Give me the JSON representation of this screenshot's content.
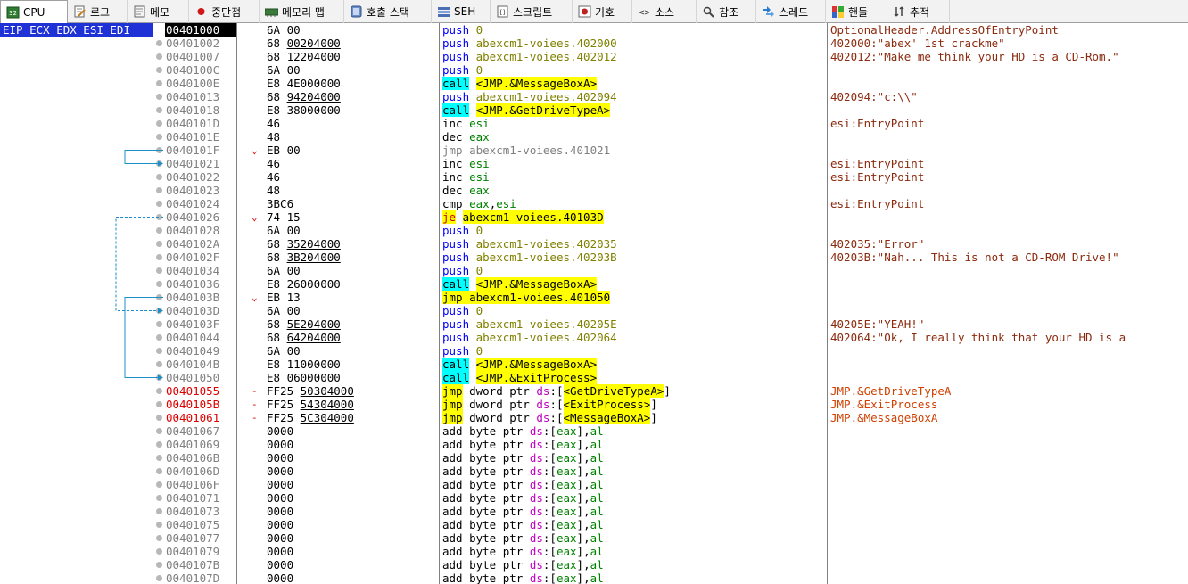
{
  "tabs": [
    {
      "label": "CPU",
      "icon": "cpu-icon",
      "active": true
    },
    {
      "label": "로그",
      "icon": "log-icon"
    },
    {
      "label": "메모",
      "icon": "notes-icon"
    },
    {
      "label": "중단점",
      "icon": "breakpoint-icon"
    },
    {
      "label": "메모리 맵",
      "icon": "memory-map-icon"
    },
    {
      "label": "호출 스택",
      "icon": "call-stack-icon"
    },
    {
      "label": "SEH",
      "icon": "seh-icon"
    },
    {
      "label": "스크립트",
      "icon": "script-icon"
    },
    {
      "label": "기호",
      "icon": "symbols-icon"
    },
    {
      "label": "소스",
      "icon": "source-icon"
    },
    {
      "label": "참조",
      "icon": "references-icon"
    },
    {
      "label": "스레드",
      "icon": "threads-icon"
    },
    {
      "label": "핸들",
      "icon": "handles-icon"
    },
    {
      "label": "추적",
      "icon": "trace-icon"
    }
  ],
  "register_label": "EIP ECX EDX ESI EDI",
  "rows": [
    {
      "addr": "00401000",
      "bytes": [
        [
          "6A 00",
          false
        ]
      ],
      "ins": [
        [
          "push",
          "mn-push"
        ],
        [
          " 0",
          "op-olive"
        ]
      ],
      "cmt": [
        [
          "OptionalHeader.AddressOfEntryPoint",
          "cm-brown"
        ]
      ],
      "current": true
    },
    {
      "addr": "00401002",
      "bytes": [
        [
          "68 ",
          false
        ],
        [
          "00204000",
          true
        ]
      ],
      "ins": [
        [
          "push",
          "mn-push"
        ],
        [
          " abexcm1-voiees.402000",
          "op-olive"
        ]
      ],
      "cmt": [
        [
          "402000:\"abex' 1st crackme\"",
          "cm-brown"
        ]
      ]
    },
    {
      "addr": "00401007",
      "bytes": [
        [
          "68 ",
          false
        ],
        [
          "12204000",
          true
        ]
      ],
      "ins": [
        [
          "push",
          "mn-push"
        ],
        [
          " abexcm1-voiees.402012",
          "op-olive"
        ]
      ],
      "cmt": [
        [
          "402012:\"Make me think your HD is a CD-Rom.\"",
          "cm-brown"
        ]
      ]
    },
    {
      "addr": "0040100C",
      "bytes": [
        [
          "6A 00",
          false
        ]
      ],
      "ins": [
        [
          "push",
          "mn-push"
        ],
        [
          " 0",
          "op-olive"
        ]
      ],
      "cmt": []
    },
    {
      "addr": "0040100E",
      "bytes": [
        [
          "E8 4E000000",
          false
        ]
      ],
      "ins": [
        [
          "call",
          "mn-blk hl-c"
        ],
        [
          " ",
          "op-blk"
        ],
        [
          "<JMP.&MessageBoxA>",
          "op-blk hl-y"
        ]
      ],
      "cmt": []
    },
    {
      "addr": "00401013",
      "bytes": [
        [
          "68 ",
          false
        ],
        [
          "94204000",
          true
        ]
      ],
      "ins": [
        [
          "push",
          "mn-push"
        ],
        [
          " abexcm1-voiees.402094",
          "op-olive"
        ]
      ],
      "cmt": [
        [
          "402094:\"c:\\\\\"",
          "cm-brown"
        ]
      ]
    },
    {
      "addr": "00401018",
      "bytes": [
        [
          "E8 38000000",
          false
        ]
      ],
      "ins": [
        [
          "call",
          "mn-blk hl-c"
        ],
        [
          " ",
          "op-blk"
        ],
        [
          "<JMP.&GetDriveTypeA>",
          "op-blk hl-y"
        ]
      ],
      "cmt": []
    },
    {
      "addr": "0040101D",
      "bytes": [
        [
          "46",
          false
        ]
      ],
      "ins": [
        [
          "inc",
          "mn-blk"
        ],
        [
          " esi",
          "op-gr"
        ]
      ],
      "cmt": [
        [
          "esi:EntryPoint",
          "cm-brown"
        ]
      ]
    },
    {
      "addr": "0040101E",
      "bytes": [
        [
          "48",
          false
        ]
      ],
      "ins": [
        [
          "dec",
          "mn-blk"
        ],
        [
          " eax",
          "op-gr"
        ]
      ],
      "cmt": []
    },
    {
      "addr": "0040101F",
      "mark": "⌄",
      "bytes": [
        [
          "EB 00",
          false
        ]
      ],
      "ins": [
        [
          "jmp",
          "mn-gray"
        ],
        [
          " abexcm1-voiees.401021",
          "op-gray"
        ]
      ],
      "cmt": []
    },
    {
      "addr": "00401021",
      "bytes": [
        [
          "46",
          false
        ]
      ],
      "ins": [
        [
          "inc",
          "mn-blk"
        ],
        [
          " esi",
          "op-gr"
        ]
      ],
      "cmt": [
        [
          "esi:EntryPoint",
          "cm-brown"
        ]
      ]
    },
    {
      "addr": "00401022",
      "bytes": [
        [
          "46",
          false
        ]
      ],
      "ins": [
        [
          "inc",
          "mn-blk"
        ],
        [
          " esi",
          "op-gr"
        ]
      ],
      "cmt": [
        [
          "esi:EntryPoint",
          "cm-brown"
        ]
      ]
    },
    {
      "addr": "00401023",
      "bytes": [
        [
          "48",
          false
        ]
      ],
      "ins": [
        [
          "dec",
          "mn-blk"
        ],
        [
          " eax",
          "op-gr"
        ]
      ],
      "cmt": []
    },
    {
      "addr": "00401024",
      "bytes": [
        [
          "3BC6",
          false
        ]
      ],
      "ins": [
        [
          "cmp",
          "mn-blk"
        ],
        [
          " eax",
          "op-gr"
        ],
        [
          ",",
          "op-blk"
        ],
        [
          "esi",
          "op-gr"
        ]
      ],
      "cmt": [
        [
          "esi:EntryPoint",
          "cm-brown"
        ]
      ]
    },
    {
      "addr": "00401026",
      "mark": "⌄",
      "bytes": [
        [
          "74 15",
          false
        ]
      ],
      "ins": [
        [
          "je",
          "mn-blk hl-y op-red"
        ],
        [
          " ",
          "op-blk"
        ],
        [
          "abexcm1-voiees.40103D",
          "op-blk hl-y"
        ]
      ],
      "cmt": []
    },
    {
      "addr": "00401028",
      "bytes": [
        [
          "6A 00",
          false
        ]
      ],
      "ins": [
        [
          "push",
          "mn-push"
        ],
        [
          " 0",
          "op-olive"
        ]
      ],
      "cmt": []
    },
    {
      "addr": "0040102A",
      "bytes": [
        [
          "68 ",
          false
        ],
        [
          "35204000",
          true
        ]
      ],
      "ins": [
        [
          "push",
          "mn-push"
        ],
        [
          " abexcm1-voiees.402035",
          "op-olive"
        ]
      ],
      "cmt": [
        [
          "402035:\"Error\"",
          "cm-brown"
        ]
      ]
    },
    {
      "addr": "0040102F",
      "bytes": [
        [
          "68 ",
          false
        ],
        [
          "3B204000",
          true
        ]
      ],
      "ins": [
        [
          "push",
          "mn-push"
        ],
        [
          " abexcm1-voiees.40203B",
          "op-olive"
        ]
      ],
      "cmt": [
        [
          "40203B:\"Nah... This is not a CD-ROM Drive!\"",
          "cm-brown"
        ]
      ]
    },
    {
      "addr": "00401034",
      "bytes": [
        [
          "6A 00",
          false
        ]
      ],
      "ins": [
        [
          "push",
          "mn-push"
        ],
        [
          " 0",
          "op-olive"
        ]
      ],
      "cmt": []
    },
    {
      "addr": "00401036",
      "bytes": [
        [
          "E8 26000000",
          false
        ]
      ],
      "ins": [
        [
          "call",
          "mn-blk hl-c"
        ],
        [
          " ",
          "op-blk"
        ],
        [
          "<JMP.&MessageBoxA>",
          "op-blk hl-y"
        ]
      ],
      "cmt": []
    },
    {
      "addr": "0040103B",
      "mark": "⌄",
      "bytes": [
        [
          "EB 13",
          false
        ]
      ],
      "ins": [
        [
          "jmp",
          "mn-blk hl-y"
        ],
        [
          " ",
          "op-blk hl-y"
        ],
        [
          "abexcm1-voiees.401050",
          "op-blk hl-y"
        ]
      ],
      "cmt": []
    },
    {
      "addr": "0040103D",
      "bytes": [
        [
          "6A 00",
          false
        ]
      ],
      "ins": [
        [
          "push",
          "mn-push"
        ],
        [
          " 0",
          "op-olive"
        ]
      ],
      "cmt": []
    },
    {
      "addr": "0040103F",
      "bytes": [
        [
          "68 ",
          false
        ],
        [
          "5E204000",
          true
        ]
      ],
      "ins": [
        [
          "push",
          "mn-push"
        ],
        [
          " abexcm1-voiees.40205E",
          "op-olive"
        ]
      ],
      "cmt": [
        [
          "40205E:\"YEAH!\"",
          "cm-brown"
        ]
      ]
    },
    {
      "addr": "00401044",
      "bytes": [
        [
          "68 ",
          false
        ],
        [
          "64204000",
          true
        ]
      ],
      "ins": [
        [
          "push",
          "mn-push"
        ],
        [
          " abexcm1-voiees.402064",
          "op-olive"
        ]
      ],
      "cmt": [
        [
          "402064:\"Ok, I really think that your HD is a",
          "cm-brown"
        ]
      ]
    },
    {
      "addr": "00401049",
      "bytes": [
        [
          "6A 00",
          false
        ]
      ],
      "ins": [
        [
          "push",
          "mn-push"
        ],
        [
          " 0",
          "op-olive"
        ]
      ],
      "cmt": []
    },
    {
      "addr": "0040104B",
      "bytes": [
        [
          "E8 11000000",
          false
        ]
      ],
      "ins": [
        [
          "call",
          "mn-blk hl-c"
        ],
        [
          " ",
          "op-blk"
        ],
        [
          "<JMP.&MessageBoxA>",
          "op-blk hl-y"
        ]
      ],
      "cmt": []
    },
    {
      "addr": "00401050",
      "bytes": [
        [
          "E8 06000000",
          false
        ]
      ],
      "ins": [
        [
          "call",
          "mn-blk hl-c"
        ],
        [
          " ",
          "op-blk"
        ],
        [
          "<JMP.&ExitProcess>",
          "op-blk hl-y"
        ]
      ],
      "cmt": []
    },
    {
      "addr": "00401055",
      "red": true,
      "mark": "-",
      "bytes": [
        [
          "FF25 ",
          false
        ],
        [
          "50304000",
          true
        ]
      ],
      "ins": [
        [
          "jmp",
          "mn-blk hl-y"
        ],
        [
          " dword ptr ",
          "op-blk"
        ],
        [
          "ds",
          "op-pink"
        ],
        [
          ":[",
          "op-blk"
        ],
        [
          "<GetDriveTypeA>",
          "op-blk hl-y"
        ],
        [
          "]",
          "op-blk"
        ]
      ],
      "cmt": [
        [
          "JMP.&GetDriveTypeA",
          "cm-eb"
        ]
      ]
    },
    {
      "addr": "0040105B",
      "red": true,
      "mark": "-",
      "bytes": [
        [
          "FF25 ",
          false
        ],
        [
          "54304000",
          true
        ]
      ],
      "ins": [
        [
          "jmp",
          "mn-blk hl-y"
        ],
        [
          " dword ptr ",
          "op-blk"
        ],
        [
          "ds",
          "op-pink"
        ],
        [
          ":[",
          "op-blk"
        ],
        [
          "<ExitProcess>",
          "op-blk hl-y"
        ],
        [
          "]",
          "op-blk"
        ]
      ],
      "cmt": [
        [
          "JMP.&ExitProcess",
          "cm-eb"
        ]
      ]
    },
    {
      "addr": "00401061",
      "red": true,
      "mark": "-",
      "bytes": [
        [
          "FF25 ",
          false
        ],
        [
          "5C304000",
          true
        ]
      ],
      "ins": [
        [
          "jmp",
          "mn-blk hl-y"
        ],
        [
          " dword ptr ",
          "op-blk"
        ],
        [
          "ds",
          "op-pink"
        ],
        [
          ":[",
          "op-blk"
        ],
        [
          "<MessageBoxA>",
          "op-blk hl-y"
        ],
        [
          "]",
          "op-blk"
        ]
      ],
      "cmt": [
        [
          "JMP.&MessageBoxA",
          "cm-eb"
        ]
      ]
    },
    {
      "addr": "00401067",
      "bytes": [
        [
          "0000",
          false
        ]
      ],
      "ins": "ADD",
      "cmt": []
    },
    {
      "addr": "00401069",
      "bytes": [
        [
          "0000",
          false
        ]
      ],
      "ins": "ADD",
      "cmt": []
    },
    {
      "addr": "0040106B",
      "bytes": [
        [
          "0000",
          false
        ]
      ],
      "ins": "ADD",
      "cmt": []
    },
    {
      "addr": "0040106D",
      "bytes": [
        [
          "0000",
          false
        ]
      ],
      "ins": "ADD",
      "cmt": []
    },
    {
      "addr": "0040106F",
      "bytes": [
        [
          "0000",
          false
        ]
      ],
      "ins": "ADD",
      "cmt": []
    },
    {
      "addr": "00401071",
      "bytes": [
        [
          "0000",
          false
        ]
      ],
      "ins": "ADD",
      "cmt": []
    },
    {
      "addr": "00401073",
      "bytes": [
        [
          "0000",
          false
        ]
      ],
      "ins": "ADD",
      "cmt": []
    },
    {
      "addr": "00401075",
      "bytes": [
        [
          "0000",
          false
        ]
      ],
      "ins": "ADD",
      "cmt": []
    },
    {
      "addr": "00401077",
      "bytes": [
        [
          "0000",
          false
        ]
      ],
      "ins": "ADD",
      "cmt": []
    },
    {
      "addr": "00401079",
      "bytes": [
        [
          "0000",
          false
        ]
      ],
      "ins": "ADD",
      "cmt": []
    },
    {
      "addr": "0040107B",
      "bytes": [
        [
          "0000",
          false
        ]
      ],
      "ins": "ADD",
      "cmt": []
    },
    {
      "addr": "0040107D",
      "bytes": [
        [
          "0000",
          false
        ]
      ],
      "ins": "ADD",
      "cmt": []
    }
  ],
  "add_ins": [
    [
      "add",
      "mn-blk"
    ],
    [
      " byte ptr ",
      "op-blk"
    ],
    [
      "ds",
      "op-pink"
    ],
    [
      ":[",
      "op-blk"
    ],
    [
      "eax",
      "op-gr"
    ],
    [
      "],",
      "op-blk"
    ],
    [
      "al",
      "op-gr"
    ]
  ],
  "colors": {
    "register_bg": "#1f32d6",
    "current_addr_bg": "#000000",
    "highlight_yellow": "#ffff00",
    "highlight_cyan": "#00ffff",
    "jump_arrow": "#1a8fc8"
  }
}
